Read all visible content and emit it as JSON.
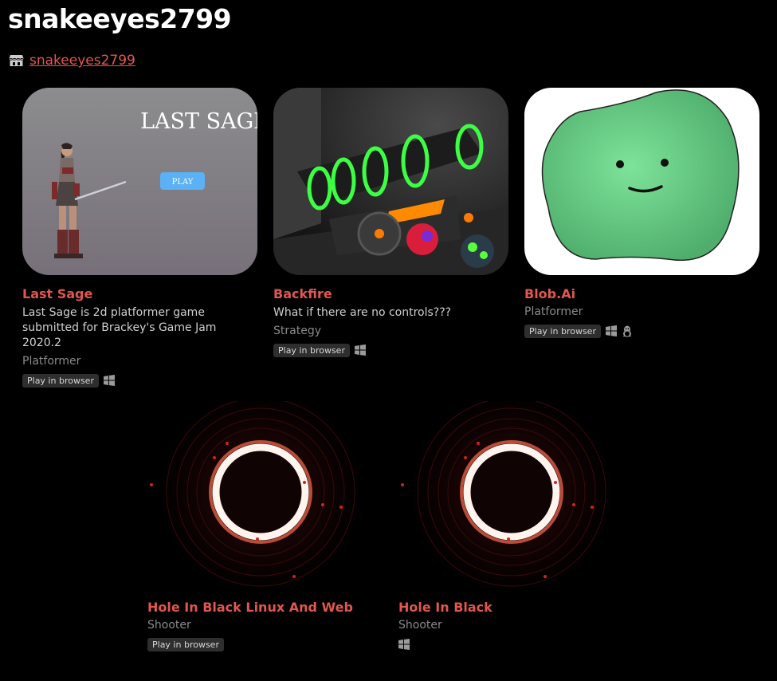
{
  "profile": {
    "name": "snakeeyes2799",
    "link_text": "snakeeyes2799"
  },
  "colors": {
    "background": "#000000",
    "title_accent": "#e0574f",
    "badge_bg": "#2e2e2e"
  },
  "games": [
    {
      "title": "Last Sage",
      "description": "Last Sage is 2d platformer game submitted for Brackey's Game Jam 2020.2",
      "genre": "Platformer",
      "badge": "Play in browser",
      "platforms": [
        "windows-icon"
      ],
      "thumb_title": "LAST SAGE",
      "thumb_button": "PLAY"
    },
    {
      "title": "Backfire",
      "description": "What if there are no controls???",
      "genre": "Strategy",
      "badge": "Play in browser",
      "platforms": [
        "windows-icon"
      ]
    },
    {
      "title": "Blob.Ai",
      "description": "",
      "genre": "Platformer",
      "badge": "Play in browser",
      "platforms": [
        "windows-icon",
        "linux-icon"
      ]
    },
    {
      "title": "Hole In Black Linux And Web",
      "description": "",
      "genre": "Shooter",
      "badge": "Play in browser",
      "platforms": []
    },
    {
      "title": "Hole In Black",
      "description": "",
      "genre": "Shooter",
      "badge": "",
      "platforms": [
        "windows-icon"
      ]
    }
  ]
}
